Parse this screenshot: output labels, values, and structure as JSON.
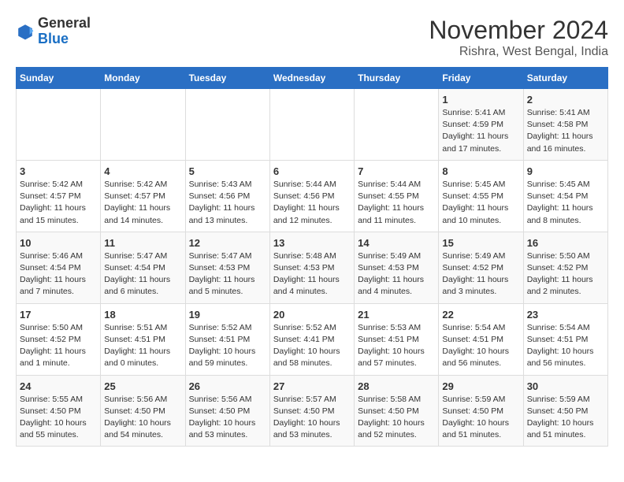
{
  "header": {
    "logo_line1": "General",
    "logo_line2": "Blue",
    "month_title": "November 2024",
    "location": "Rishra, West Bengal, India"
  },
  "weekdays": [
    "Sunday",
    "Monday",
    "Tuesday",
    "Wednesday",
    "Thursday",
    "Friday",
    "Saturday"
  ],
  "weeks": [
    [
      {
        "day": "",
        "info": ""
      },
      {
        "day": "",
        "info": ""
      },
      {
        "day": "",
        "info": ""
      },
      {
        "day": "",
        "info": ""
      },
      {
        "day": "",
        "info": ""
      },
      {
        "day": "1",
        "info": "Sunrise: 5:41 AM\nSunset: 4:59 PM\nDaylight: 11 hours and 17 minutes."
      },
      {
        "day": "2",
        "info": "Sunrise: 5:41 AM\nSunset: 4:58 PM\nDaylight: 11 hours and 16 minutes."
      }
    ],
    [
      {
        "day": "3",
        "info": "Sunrise: 5:42 AM\nSunset: 4:57 PM\nDaylight: 11 hours and 15 minutes."
      },
      {
        "day": "4",
        "info": "Sunrise: 5:42 AM\nSunset: 4:57 PM\nDaylight: 11 hours and 14 minutes."
      },
      {
        "day": "5",
        "info": "Sunrise: 5:43 AM\nSunset: 4:56 PM\nDaylight: 11 hours and 13 minutes."
      },
      {
        "day": "6",
        "info": "Sunrise: 5:44 AM\nSunset: 4:56 PM\nDaylight: 11 hours and 12 minutes."
      },
      {
        "day": "7",
        "info": "Sunrise: 5:44 AM\nSunset: 4:55 PM\nDaylight: 11 hours and 11 minutes."
      },
      {
        "day": "8",
        "info": "Sunrise: 5:45 AM\nSunset: 4:55 PM\nDaylight: 11 hours and 10 minutes."
      },
      {
        "day": "9",
        "info": "Sunrise: 5:45 AM\nSunset: 4:54 PM\nDaylight: 11 hours and 8 minutes."
      }
    ],
    [
      {
        "day": "10",
        "info": "Sunrise: 5:46 AM\nSunset: 4:54 PM\nDaylight: 11 hours and 7 minutes."
      },
      {
        "day": "11",
        "info": "Sunrise: 5:47 AM\nSunset: 4:54 PM\nDaylight: 11 hours and 6 minutes."
      },
      {
        "day": "12",
        "info": "Sunrise: 5:47 AM\nSunset: 4:53 PM\nDaylight: 11 hours and 5 minutes."
      },
      {
        "day": "13",
        "info": "Sunrise: 5:48 AM\nSunset: 4:53 PM\nDaylight: 11 hours and 4 minutes."
      },
      {
        "day": "14",
        "info": "Sunrise: 5:49 AM\nSunset: 4:53 PM\nDaylight: 11 hours and 4 minutes."
      },
      {
        "day": "15",
        "info": "Sunrise: 5:49 AM\nSunset: 4:52 PM\nDaylight: 11 hours and 3 minutes."
      },
      {
        "day": "16",
        "info": "Sunrise: 5:50 AM\nSunset: 4:52 PM\nDaylight: 11 hours and 2 minutes."
      }
    ],
    [
      {
        "day": "17",
        "info": "Sunrise: 5:50 AM\nSunset: 4:52 PM\nDaylight: 11 hours and 1 minute."
      },
      {
        "day": "18",
        "info": "Sunrise: 5:51 AM\nSunset: 4:51 PM\nDaylight: 11 hours and 0 minutes."
      },
      {
        "day": "19",
        "info": "Sunrise: 5:52 AM\nSunset: 4:51 PM\nDaylight: 10 hours and 59 minutes."
      },
      {
        "day": "20",
        "info": "Sunrise: 5:52 AM\nSunset: 4:41 PM\nDaylight: 10 hours and 58 minutes."
      },
      {
        "day": "21",
        "info": "Sunrise: 5:53 AM\nSunset: 4:51 PM\nDaylight: 10 hours and 57 minutes."
      },
      {
        "day": "22",
        "info": "Sunrise: 5:54 AM\nSunset: 4:51 PM\nDaylight: 10 hours and 56 minutes."
      },
      {
        "day": "23",
        "info": "Sunrise: 5:54 AM\nSunset: 4:51 PM\nDaylight: 10 hours and 56 minutes."
      }
    ],
    [
      {
        "day": "24",
        "info": "Sunrise: 5:55 AM\nSunset: 4:50 PM\nDaylight: 10 hours and 55 minutes."
      },
      {
        "day": "25",
        "info": "Sunrise: 5:56 AM\nSunset: 4:50 PM\nDaylight: 10 hours and 54 minutes."
      },
      {
        "day": "26",
        "info": "Sunrise: 5:56 AM\nSunset: 4:50 PM\nDaylight: 10 hours and 53 minutes."
      },
      {
        "day": "27",
        "info": "Sunrise: 5:57 AM\nSunset: 4:50 PM\nDaylight: 10 hours and 53 minutes."
      },
      {
        "day": "28",
        "info": "Sunrise: 5:58 AM\nSunset: 4:50 PM\nDaylight: 10 hours and 52 minutes."
      },
      {
        "day": "29",
        "info": "Sunrise: 5:59 AM\nSunset: 4:50 PM\nDaylight: 10 hours and 51 minutes."
      },
      {
        "day": "30",
        "info": "Sunrise: 5:59 AM\nSunset: 4:50 PM\nDaylight: 10 hours and 51 minutes."
      }
    ]
  ]
}
